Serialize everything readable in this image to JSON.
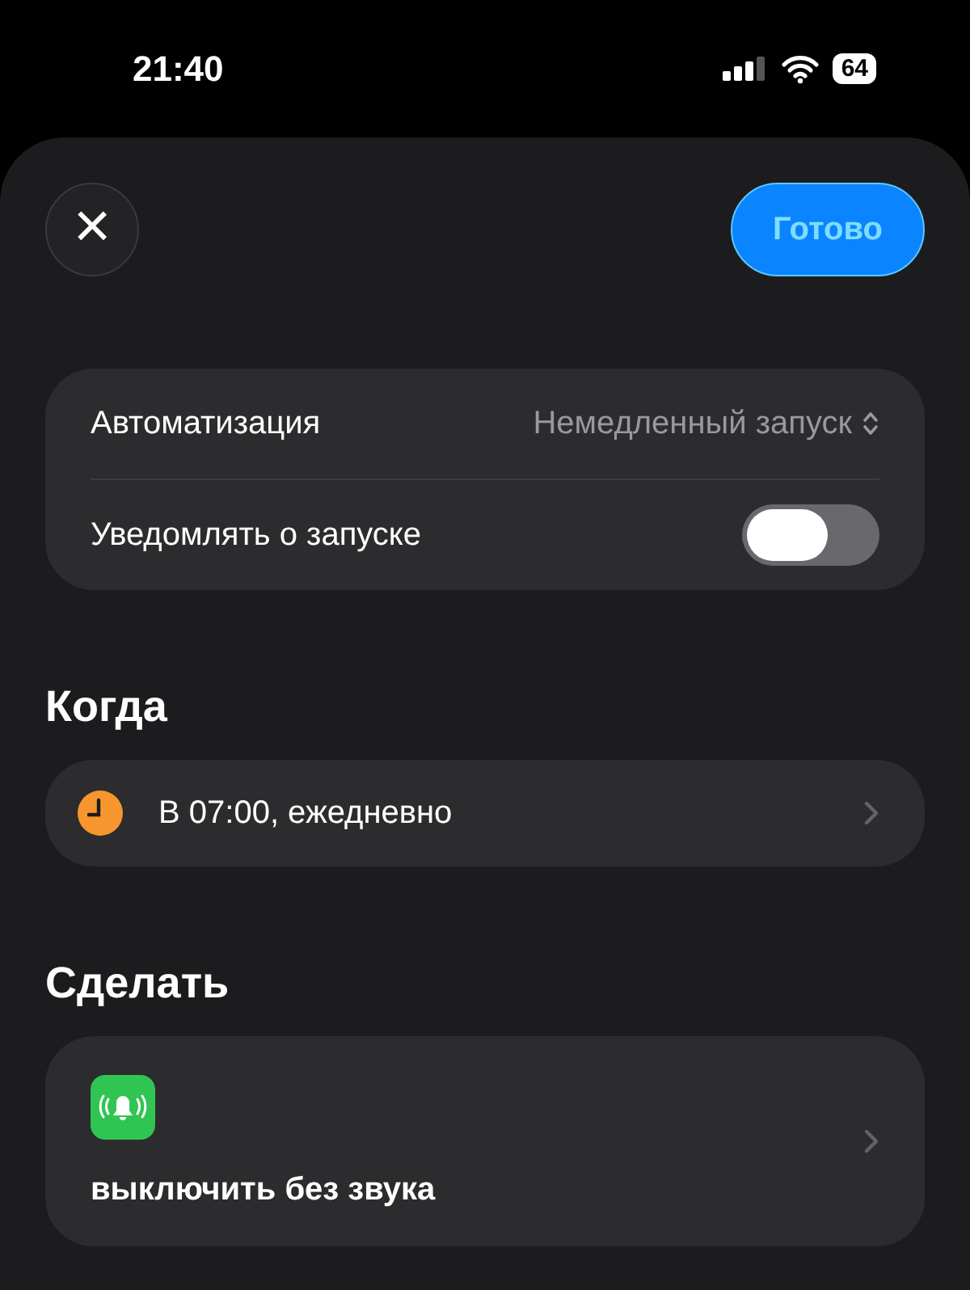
{
  "status_bar": {
    "time": "21:40",
    "battery": "64"
  },
  "header": {
    "close": "×",
    "done": "Готово"
  },
  "settings": [
    {
      "kind": "picker",
      "label": "Автоматизация",
      "value": "Немедленный запуск"
    },
    {
      "kind": "toggle",
      "label": "Уведомлять о запуске",
      "on": false
    }
  ],
  "when": {
    "title": "Когда",
    "trigger": "В 07:00, ежедневно"
  },
  "do": {
    "title": "Сделать",
    "action": "выключить без звука"
  }
}
